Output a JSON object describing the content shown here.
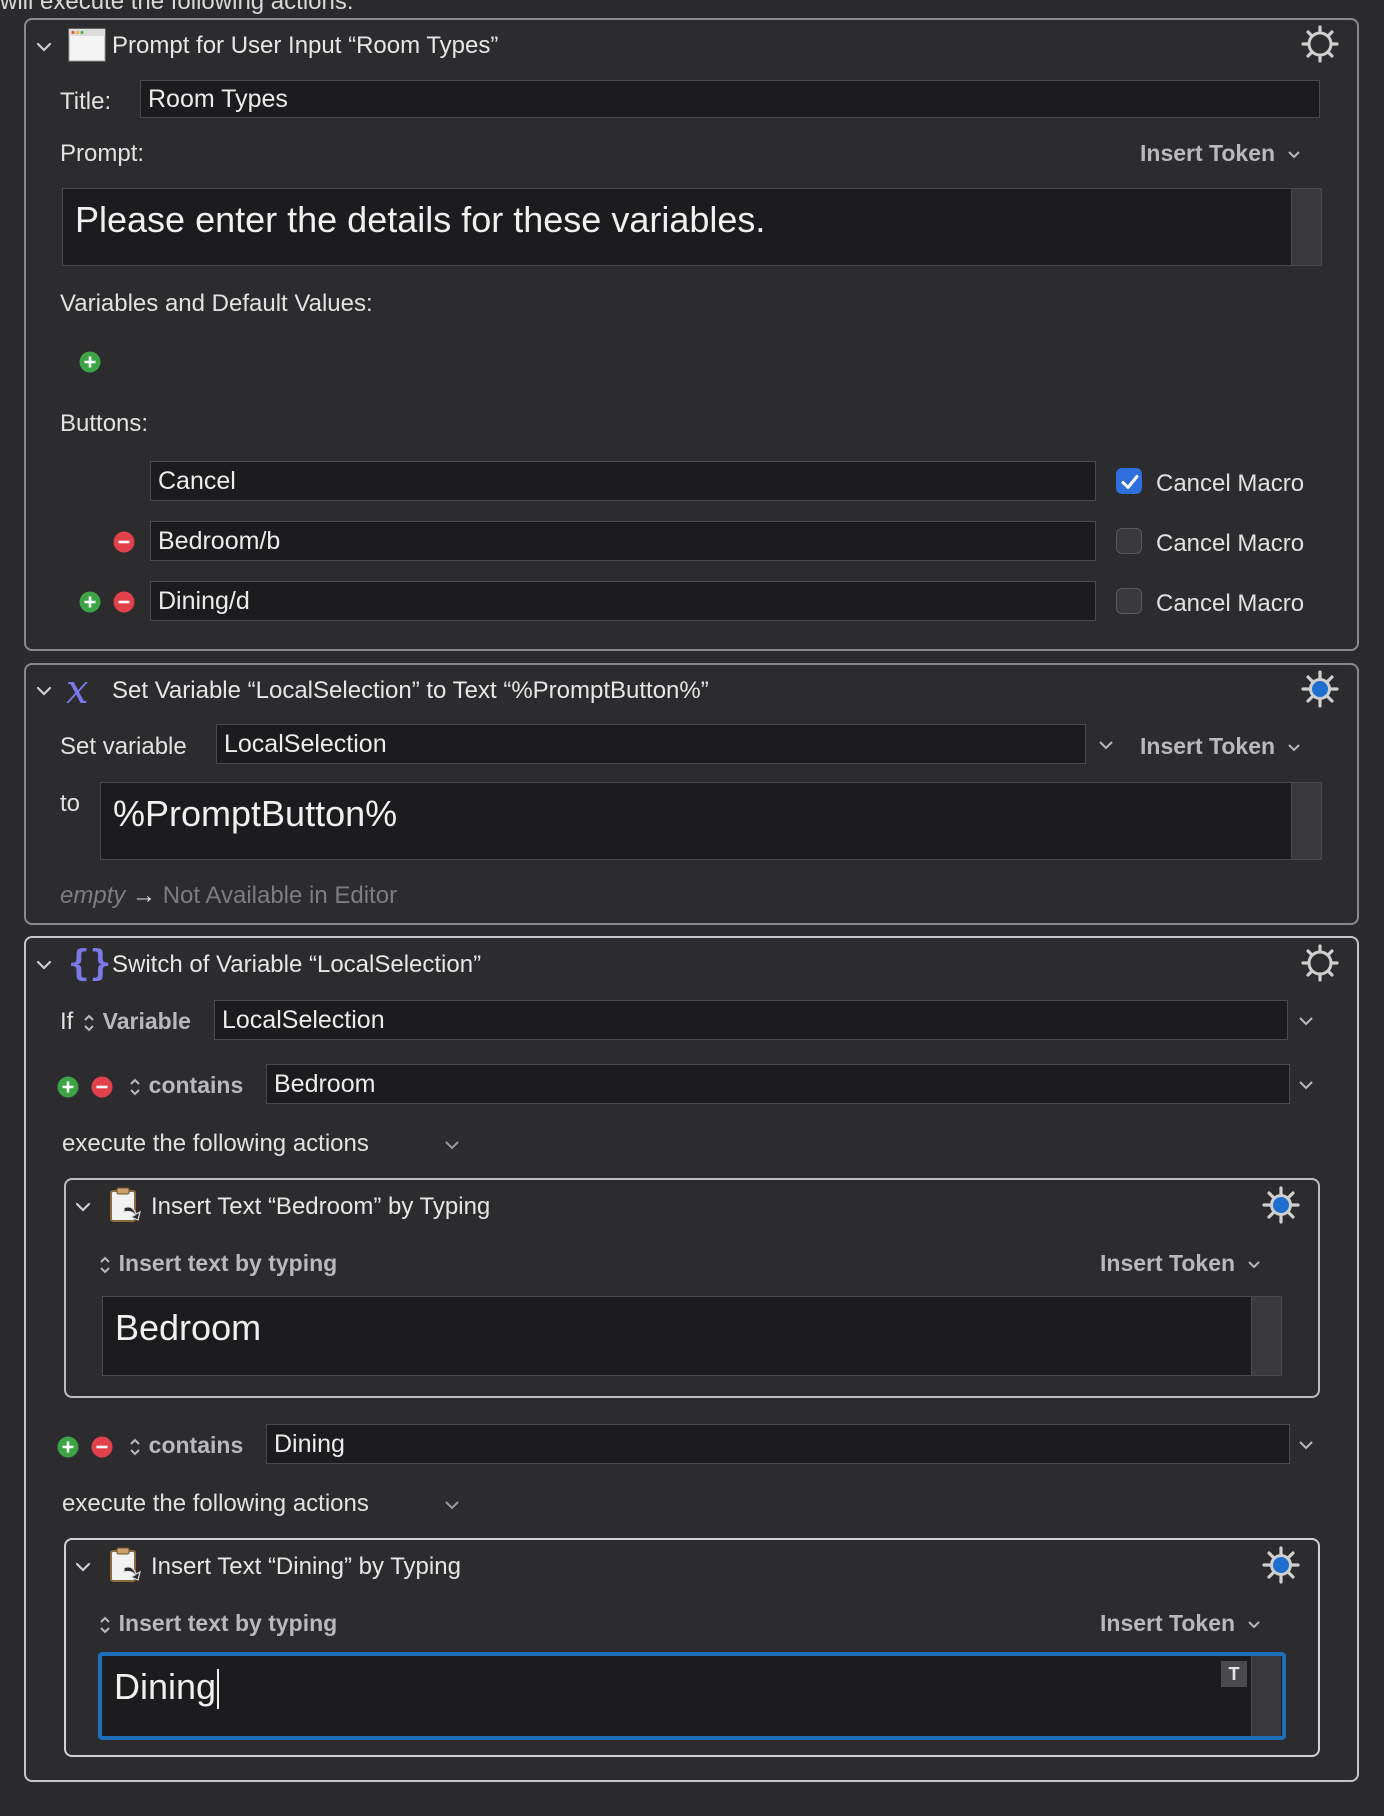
{
  "top_cut_text": "will execute the following actions:",
  "prompt_action": {
    "title": "Prompt for User Input “Room Types”",
    "title_label": "Title:",
    "title_value": "Room Types",
    "prompt_label": "Prompt:",
    "insert_token": "Insert Token",
    "prompt_text": "Please enter the details for these variables.",
    "variables_label": "Variables and Default Values:",
    "buttons_label": "Buttons:",
    "buttons": [
      {
        "name": "Cancel",
        "cancel_label": "Cancel Macro",
        "cancel_checked": true
      },
      {
        "name": "Bedroom/b",
        "cancel_label": "Cancel Macro",
        "cancel_checked": false
      },
      {
        "name": "Dining/d",
        "cancel_label": "Cancel Macro",
        "cancel_checked": false
      }
    ]
  },
  "set_variable_action": {
    "title": "Set Variable “LocalSelection” to Text “%PromptButton%”",
    "set_label": "Set variable",
    "variable_name": "LocalSelection",
    "insert_token": "Insert Token",
    "to_label": "to",
    "value": "%PromptButton%",
    "preview_empty": "empty",
    "preview_arrow": "→",
    "preview_text": "Not Available in Editor"
  },
  "switch_action": {
    "title": "Switch of Variable “LocalSelection”",
    "if_label": "If",
    "source_label": "Variable",
    "variable_value": "LocalSelection",
    "cases": [
      {
        "operator": "contains",
        "value": "Bedroom",
        "execute_label": "execute the following actions",
        "insert_action": {
          "title": "Insert Text “Bedroom” by Typing",
          "mode_label": "Insert text by typing",
          "insert_token": "Insert Token",
          "text": "Bedroom"
        }
      },
      {
        "operator": "contains",
        "value": "Dining",
        "execute_label": "execute the following actions",
        "insert_action": {
          "title": "Insert Text “Dining” by Typing",
          "mode_label": "Insert text by typing",
          "insert_token": "Insert Token",
          "text": "Dining",
          "text_badge": "T"
        }
      }
    ]
  },
  "colors": {
    "background": "#2b2b2d",
    "field": "#1c1c1e",
    "accent_blue": "#2f6fdd",
    "focus_ring": "#1e6fb8",
    "add_green": "#3ca445",
    "remove_red": "#e0414b",
    "variable_icon": "#7b78e8"
  }
}
